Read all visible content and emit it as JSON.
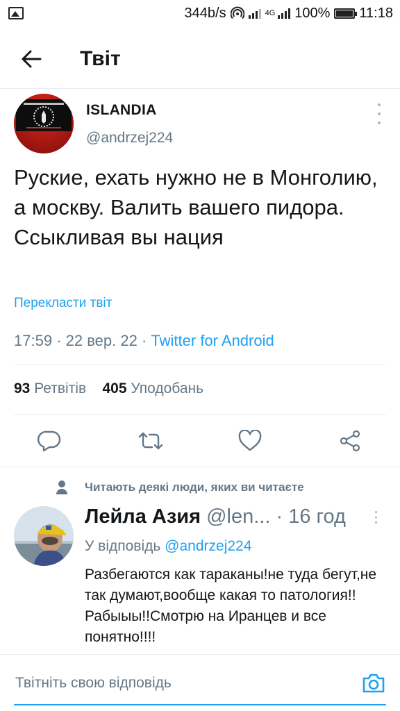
{
  "status_bar": {
    "network_speed": "344b/s",
    "network_type": "4G",
    "battery": "100%",
    "time": "11:18",
    "icons": [
      "image-icon",
      "hotspot-icon",
      "signal-icon",
      "signal-4g-icon",
      "battery-icon"
    ]
  },
  "header": {
    "title": "Твіт",
    "back_icon": "arrow-left-icon"
  },
  "tweet": {
    "author_name": "ISLANDIA",
    "author_handle": "@andrzej224",
    "text": "Руские, ехать нужно не в Монголию, а москву. Валить вашего пидора. Ссыкливая вы нация",
    "translate_label": "Перекласти твіт",
    "time": "17:59",
    "date": "22 вер. 22",
    "meta_separator": "·",
    "source": "Twitter for Android",
    "retweets_count": "93",
    "retweets_label": "Ретвітів",
    "likes_count": "405",
    "likes_label": "Уподобань",
    "actions": [
      "reply-icon",
      "retweet-icon",
      "like-icon",
      "share-icon"
    ]
  },
  "reply": {
    "social_context": "Читають деякі люди, яких ви читаєте",
    "author_name": "Лейла Азия",
    "author_handle": "@len...",
    "separator": "·",
    "time": "16 год",
    "reply_to_label": "У відповідь",
    "reply_to_handle": "@andrzej224",
    "text": "Разбегаются как тараканы!не туда бегут,не так думают,вообще какая то патология!!Рабыыы!!Смотрю на Иранцев и все понятно!!!!"
  },
  "composer": {
    "placeholder": "Твітніть свою відповідь",
    "camera_icon": "camera-icon"
  },
  "colors": {
    "accent": "#1da1f2",
    "text_primary": "#14171a",
    "text_secondary": "#657786",
    "divider": "#e6ecf0"
  }
}
